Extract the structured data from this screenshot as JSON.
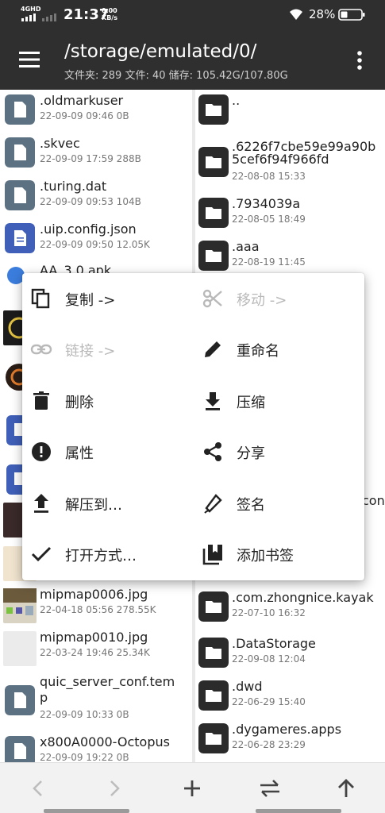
{
  "status_bar": {
    "network": "4GHD",
    "time": "21:37",
    "speed_value": "0.00",
    "speed_unit": "KB/s",
    "battery_pct": "28%"
  },
  "header": {
    "path": "/storage/emulated/0/",
    "summary": "文件夹: 289  文件: 40  储存: 105.42G/107.80G"
  },
  "left_pane": {
    "items": [
      {
        "name": ".oldmarkuser",
        "meta": "22-09-09 09:46  0B",
        "icon": "file-icon"
      },
      {
        "name": ".skvec",
        "meta": "22-09-09 17:59  288B",
        "icon": "file-icon"
      },
      {
        "name": ".turing.dat",
        "meta": "22-09-09 09:53  104B",
        "icon": "file-icon"
      },
      {
        "name": ".uip.config.json",
        "meta": "22-09-09 09:50  12.05K",
        "icon": "document-icon"
      },
      {
        "name": "AA_3.0.apk",
        "meta": "",
        "icon": "apk-icon"
      },
      {
        "name": "mipmap0006.jpg",
        "meta": "22-04-18 05:56  278.55K",
        "icon": "image-thumbnail"
      },
      {
        "name": "mipmap0010.jpg",
        "meta": "22-03-24 19:46  25.34K",
        "icon": "image-thumbnail"
      },
      {
        "name": "quic_server_conf.tem",
        "name2": "p",
        "meta": "22-09-09 10:33  0B",
        "icon": "file-icon"
      },
      {
        "name": "x800A0000-Octopus",
        "meta": "22-09-09 19:22  0B",
        "icon": "file-icon"
      }
    ]
  },
  "right_pane": {
    "items": [
      {
        "name": "..",
        "meta": ""
      },
      {
        "name": ".6226f7cbe59e99a90b",
        "name2": "5cef6f94f966fd",
        "meta": "22-08-08 15:33"
      },
      {
        "name": ".7934039a",
        "meta": "22-08-05 18:49"
      },
      {
        "name": ".aaa",
        "meta": "22-08-19 11:45"
      },
      {
        "name": "con",
        "meta": ""
      },
      {
        "name": ".com.zhongnice.kayak",
        "meta": "22-07-10 16:32"
      },
      {
        "name": ".DataStorage",
        "meta": "22-09-08 12:04"
      },
      {
        "name": ".dwd",
        "meta": "22-06-29 15:40"
      },
      {
        "name": ".dygameres.apps",
        "meta": "22-06-28 23:29"
      }
    ]
  },
  "context_menu": {
    "copy": "复制 ->",
    "move": "移动 ->",
    "link": "链接 ->",
    "rename": "重命名",
    "delete": "删除",
    "compress": "压缩",
    "properties": "属性",
    "share": "分享",
    "extract": "解压到…",
    "sign": "签名",
    "open_with": "打开方式…",
    "bookmark": "添加书签"
  },
  "colors": {
    "header_bg": "#2f2f2f",
    "file_icon": "#5c7182",
    "doc_icon": "#3f5fb8",
    "folder_icon": "#2b2b2b",
    "disabled_text": "#b9b9b9"
  }
}
